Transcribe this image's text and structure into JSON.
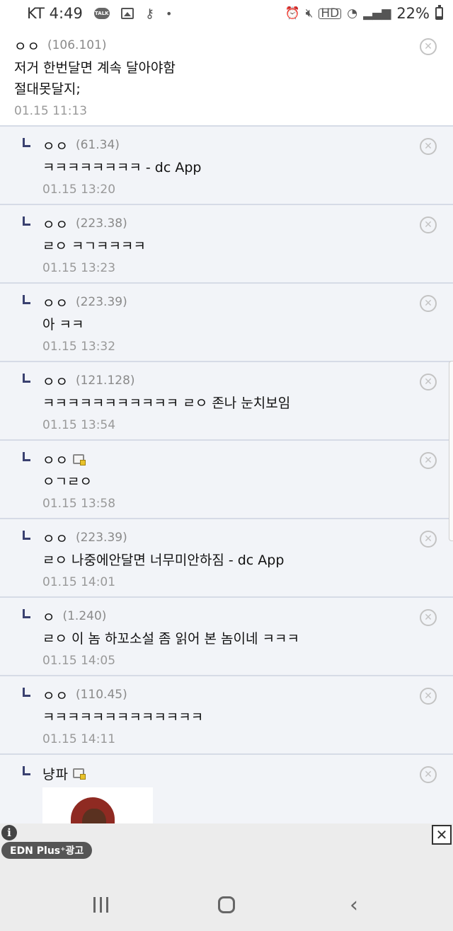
{
  "status_bar": {
    "carrier": "KT",
    "time": "4:49",
    "left_icons": [
      "kakaotalk-icon",
      "gallery-icon",
      "key-icon",
      "dot-icon"
    ],
    "right_icons": [
      "alarm-icon",
      "mute-icon",
      "hd-voice-icon",
      "wifi-icon",
      "signal-icon",
      "battery-icon"
    ],
    "hd_label": "HD",
    "battery": "22%"
  },
  "comments": [
    {
      "name": "ㅇㅇ",
      "ip": "(106.101)",
      "lines": [
        "저거 한번달면 계속 달아야함",
        "절대못달지;"
      ],
      "date": "01.15 11:13",
      "reply": false
    },
    {
      "name": "ㅇㅇ",
      "ip": "(61.34)",
      "lines": [
        "ㅋㅋㅋㅋㅋㅋㅋㅋ - dc App"
      ],
      "date": "01.15 13:20",
      "reply": true
    },
    {
      "name": "ㅇㅇ",
      "ip": "(223.38)",
      "lines": [
        "ㄹㅇ ㅋㄱㅋㅋㅋㅋ"
      ],
      "date": "01.15 13:23",
      "reply": true
    },
    {
      "name": "ㅇㅇ",
      "ip": "(223.39)",
      "lines": [
        "아 ㅋㅋ"
      ],
      "date": "01.15 13:32",
      "reply": true
    },
    {
      "name": "ㅇㅇ",
      "ip": "(121.128)",
      "lines": [
        "ㅋㅋㅋㅋㅋㅋㅋㅋㅋㅋㅋ ㄹㅇ 존나 눈치보임"
      ],
      "date": "01.15 13:54",
      "reply": true
    },
    {
      "name": "ㅇㅇ",
      "ip": "",
      "gallery_icon": true,
      "lines": [
        "ㅇㄱㄹㅇ"
      ],
      "date": "01.15 13:58",
      "reply": true
    },
    {
      "name": "ㅇㅇ",
      "ip": "(223.39)",
      "lines": [
        "ㄹㅇ 나중에안달면 너무미안하짐 - dc App"
      ],
      "date": "01.15 14:01",
      "reply": true
    },
    {
      "name": "ㅇ",
      "ip": "(1.240)",
      "lines": [
        "ㄹㅇ 이 놈 하꼬소설 좀 읽어 본 놈이네 ㅋㅋㅋ"
      ],
      "date": "01.15 14:05",
      "reply": true
    },
    {
      "name": "ㅇㅇ",
      "ip": "(110.45)",
      "lines": [
        "ㅋㅋㅋㅋㅋㅋㅋㅋㅋㅋㅋㅋㅋ"
      ],
      "date": "01.15 14:11",
      "reply": true
    },
    {
      "name": "냥파",
      "ip": "",
      "gallery_icon": true,
      "lines": [],
      "date": "",
      "reply": true,
      "has_dccon": true
    }
  ],
  "ad": {
    "info_glyph": "i",
    "label": "EDN Plus⁺광고",
    "close_glyph": "✕"
  },
  "delete_glyph": "✕",
  "navbar": {
    "back_glyph": "‹"
  }
}
